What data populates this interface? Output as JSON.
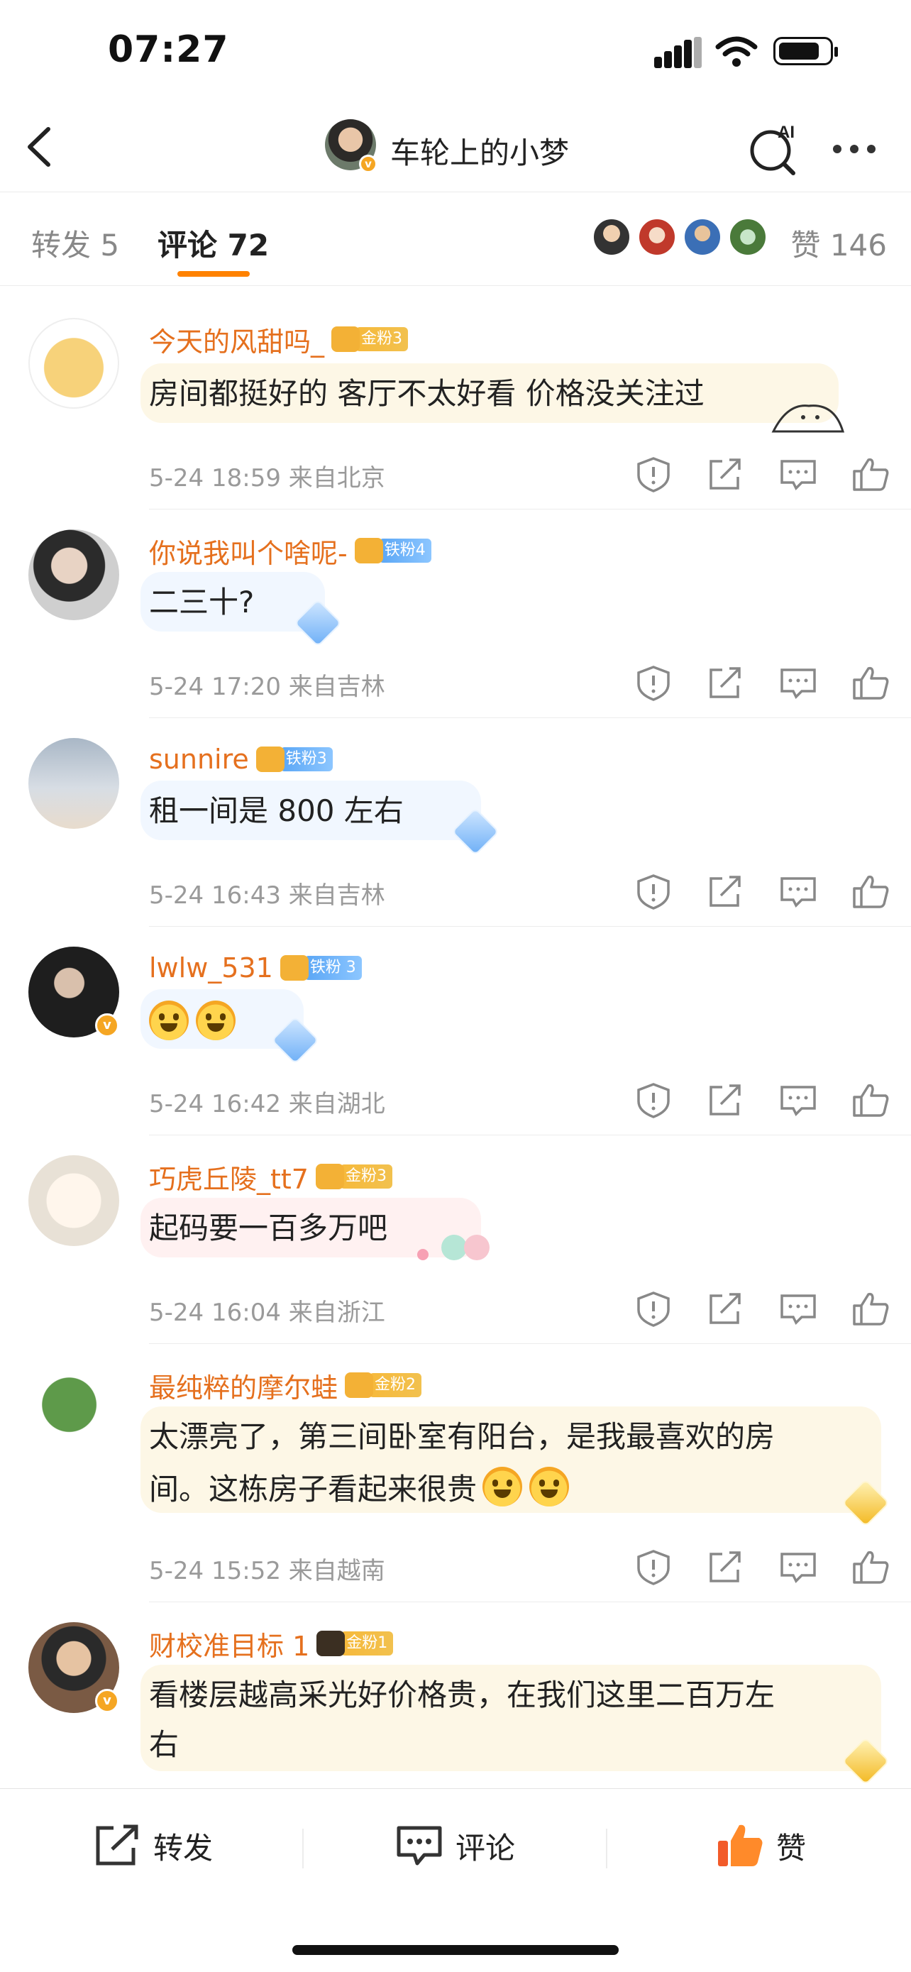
{
  "status": {
    "time": "07:27"
  },
  "nav": {
    "title": "车轮上的小梦",
    "ai_label": "AI"
  },
  "tabs": {
    "repost": "转发 5",
    "comment": "评论 72",
    "likes": "赞 146"
  },
  "comments": [
    {
      "user": "今天的风甜吗_",
      "fan_label": "金粉3",
      "fan_type": "gold",
      "text": "房间都挺好的 客厅不太好看 价格没关注过",
      "time": "5-24 18:59",
      "location": "来自北京",
      "verified": false
    },
    {
      "user": "你说我叫个啥呢-",
      "fan_label": "铁粉4",
      "fan_type": "iron",
      "text": "二三十?",
      "time": "5-24 17:20",
      "location": "来自吉林",
      "verified": false
    },
    {
      "user": "sunnire",
      "fan_label": "铁粉3",
      "fan_type": "iron",
      "text": "租一间是 800 左右",
      "time": "5-24 16:43",
      "location": "来自吉林",
      "verified": false
    },
    {
      "user": "lwlw_531",
      "fan_label": "铁粉 3",
      "fan_type": "iron",
      "text": "",
      "time": "5-24 16:42",
      "location": "来自湖北",
      "verified": true
    },
    {
      "user": "巧虎丘陵_tt7",
      "fan_label": "金粉3",
      "fan_type": "gold",
      "text": "起码要一百多万吧",
      "time": "5-24 16:04",
      "location": "来自浙江",
      "verified": false
    },
    {
      "user": "最纯粹的摩尔蛙",
      "fan_label": "金粉2",
      "fan_type": "gold",
      "text_line1": "太漂亮了，第三间卧室有阳台，是我最喜欢的房",
      "text_line2": "间。这栋房子看起来很贵",
      "time": "5-24 15:52",
      "location": "来自越南",
      "verified": false
    },
    {
      "user": "财校准目标 1",
      "fan_label": "金粉1",
      "fan_type": "gold",
      "text_line1": "看楼层越高采光好价格贵，在我们这里二百万左",
      "text_line2": "右",
      "verified": true
    }
  ],
  "bottom": {
    "repost": "转发",
    "comment": "评论",
    "like": "赞"
  },
  "colors": {
    "accent": "#ff8200",
    "username": "#e5701e",
    "meta": "#9a9a9a"
  }
}
